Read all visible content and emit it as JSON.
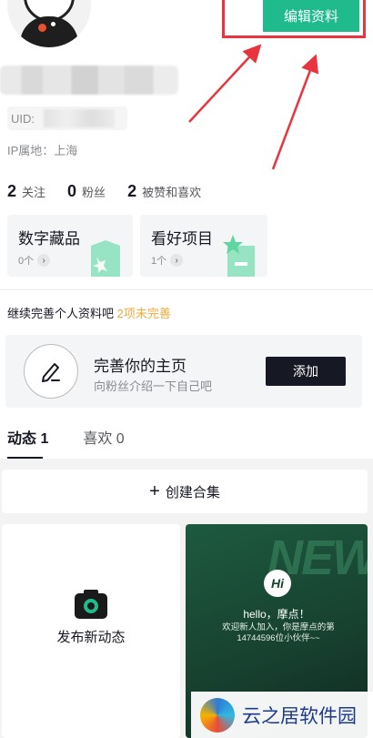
{
  "header": {
    "edit_profile_label": "编辑资料"
  },
  "profile": {
    "uid_label": "UID:",
    "ip_location": "IP属地：上海"
  },
  "stats": [
    {
      "count": "2",
      "label": "关注"
    },
    {
      "count": "0",
      "label": "粉丝"
    },
    {
      "count": "2",
      "label": "被赞和喜欢"
    }
  ],
  "cards": [
    {
      "title": "数字藏品",
      "count": "0个"
    },
    {
      "title": "看好项目",
      "count": "1个"
    }
  ],
  "completion": {
    "text": "继续完善个人资料吧",
    "remaining": "2项未完善"
  },
  "promo": {
    "title": "完善你的主页",
    "subtitle": "向粉丝介绍一下自己吧",
    "button_label": "添加"
  },
  "tabs": [
    {
      "label": "动态 1",
      "active": true
    },
    {
      "label": "喜欢 0",
      "active": false
    }
  ],
  "feed": {
    "create_collection_label": "创建合集",
    "post_label": "发布新动态",
    "welcome": {
      "badge": "Hi",
      "bg_text": "NEW",
      "hello": "hello，摩点！",
      "message": "欢迎新人加入，你是摩点的第14744596位小伙伴~~"
    }
  },
  "watermark": {
    "text": "云之居软件园"
  },
  "colors": {
    "accent_green": "#1fbb8c",
    "highlight_orange": "#f1a93a",
    "annotation_red": "#e8343e"
  }
}
